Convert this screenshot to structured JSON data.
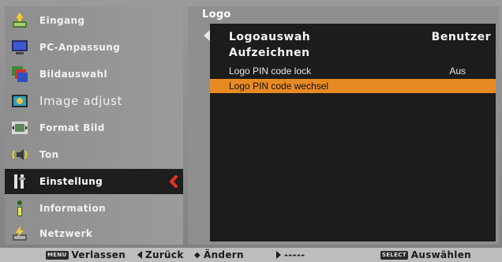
{
  "sidebar": {
    "items": [
      {
        "label": "Eingang",
        "icon": "input-icon"
      },
      {
        "label": "PC-Anpassung",
        "icon": "pc-adjust-icon"
      },
      {
        "label": "Bildauswahl",
        "icon": "image-select-icon"
      },
      {
        "label": "Image adjust",
        "icon": "image-adjust-icon"
      },
      {
        "label": "Format Bild",
        "icon": "screen-format-icon"
      },
      {
        "label": "Ton",
        "icon": "sound-icon"
      },
      {
        "label": "Einstellung",
        "icon": "setting-icon"
      },
      {
        "label": "Information",
        "icon": "information-icon"
      },
      {
        "label": "Netzwerk",
        "icon": "network-icon"
      }
    ],
    "selected_index": 6
  },
  "panel": {
    "title": "Logo",
    "rows": [
      {
        "label": "Logoauswah",
        "value": "Benutzer"
      },
      {
        "label": "Aufzeichnen",
        "value": ""
      },
      {
        "label": "Logo PIN code lock",
        "value": "Aus"
      },
      {
        "label": "Logo PIN code wechsel",
        "value": ""
      }
    ]
  },
  "bottombar": {
    "menu_key": "MENU",
    "exit_label": "Verlassen",
    "back_label": "Zurück",
    "change_label": "Ändern",
    "next_label": "-----",
    "select_key": "SELECT",
    "select_label": "Auswählen"
  },
  "colors": {
    "highlight": "#e88a24",
    "panel_bg": "#1c1c1c",
    "selected_bg": "#1e1e1e",
    "selected_arrow": "#e53322"
  }
}
